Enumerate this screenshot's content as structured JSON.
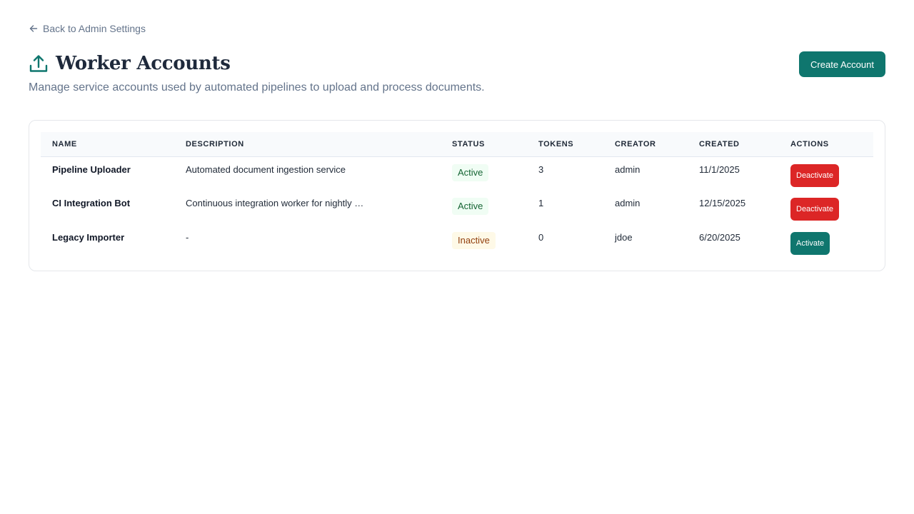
{
  "nav": {
    "back_label": "Back to Admin Settings"
  },
  "header": {
    "title": "Worker Accounts",
    "subtitle": "Manage service accounts used by automated pipelines to upload and process documents.",
    "create_label": "Create Account",
    "title_icon": "upload-icon"
  },
  "table": {
    "columns": {
      "name": "NAME",
      "description": "DESCRIPTION",
      "status": "STATUS",
      "tokens": "TOKENS",
      "creator": "CREATOR",
      "created": "CREATED",
      "actions": "ACTIONS"
    },
    "rows": [
      {
        "name": "Pipeline Uploader",
        "description": "Automated document ingestion service",
        "status": "Active",
        "tokens": "3",
        "creator": "admin",
        "created": "11/1/2025",
        "action": "Deactivate"
      },
      {
        "name": "CI Integration Bot",
        "description": "Continuous integration worker for nightly …",
        "status": "Active",
        "tokens": "1",
        "creator": "admin",
        "created": "12/15/2025",
        "action": "Deactivate"
      },
      {
        "name": "Legacy Importer",
        "description": "-",
        "status": "Inactive",
        "tokens": "0",
        "creator": "jdoe",
        "created": "6/20/2025",
        "action": "Activate"
      }
    ]
  },
  "colors": {
    "accent": "#0f766e",
    "danger": "#dc2626",
    "active_bg": "#f0fdf4",
    "active_text": "#166534",
    "inactive_bg": "#fef9e7",
    "inactive_text": "#92400e"
  }
}
